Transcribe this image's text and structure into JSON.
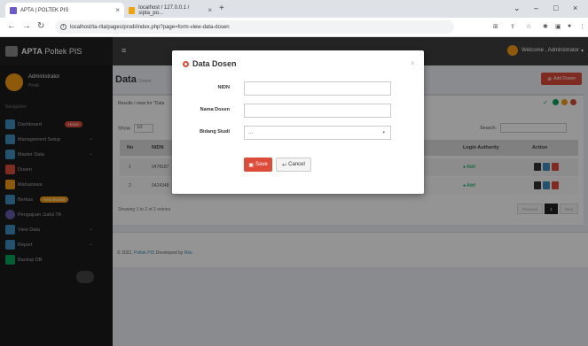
{
  "browser": {
    "tabs": [
      {
        "title": "APTA | POLTEK PIS"
      },
      {
        "title": "localhost / 127.0.0.1 / sipta_po..."
      }
    ],
    "new_tab": "+",
    "url": "localhost/ta-rita/pages/prodi/index.php?page=form-view-data-dosen",
    "win_min": "–",
    "win_max": "□",
    "win_close": "×"
  },
  "app": {
    "logo_main": "APTA",
    "logo_sub": " Poltek PIS",
    "welcome": "Welcome , Administrator"
  },
  "sidebar": {
    "user_name": "Administrator",
    "user_role": "Prodi",
    "nav_header": "Navigation",
    "items": [
      {
        "label": "Dashboard",
        "badge": "Home",
        "color": "#3c8dbc",
        "badge_color": "#dd4b39"
      },
      {
        "label": "Management Setup",
        "color": "#3c8dbc"
      },
      {
        "label": "Master Data",
        "color": "#3c8dbc"
      },
      {
        "label": "Dosen",
        "color": "#dd4b39"
      },
      {
        "label": "Mahasiswa",
        "color": "#f39c12"
      },
      {
        "label": "Berkas",
        "badge": "New Berkas",
        "color": "#3c8dbc",
        "badge_color": "#f39c12"
      },
      {
        "label": "Pengajuan Judul TA",
        "color": "#605ca8"
      },
      {
        "label": "View Data",
        "color": "#3c8dbc"
      },
      {
        "label": "Report",
        "color": "#3c8dbc"
      },
      {
        "label": "Backup DB",
        "color": "#00a65a"
      }
    ]
  },
  "content": {
    "title": "Data",
    "subtitle": "Dosen",
    "add_button": "Add Dosen",
    "results_label": "Results / rows for \"Data",
    "show_label": "Show",
    "show_value": "10",
    "search_label": "Search:",
    "columns": [
      "No",
      "NIDN",
      "Login Authority",
      "Action"
    ],
    "rows": [
      {
        "no": "1",
        "nidn": "0478187",
        "authority": "Aktif"
      },
      {
        "no": "2",
        "nidn": "0424348",
        "authority": "Aktif"
      }
    ],
    "info": "Showing 1 to 2 of 2 entries",
    "pager": {
      "prev": "Previous",
      "page": "1",
      "next": "Next"
    },
    "footer_prefix": "© 2022, ",
    "footer_link": "Poltek PIS",
    "footer_mid": " Developed by ",
    "footer_dev": "Rita"
  },
  "modal": {
    "title": "Data Dosen",
    "close": "×",
    "fields": [
      {
        "label": "NIDN",
        "value": ""
      },
      {
        "label": "Nama Dosen",
        "value": ""
      },
      {
        "label": "Bidang Studi",
        "value": "..."
      }
    ],
    "save": "Save",
    "cancel": "Cancel"
  }
}
